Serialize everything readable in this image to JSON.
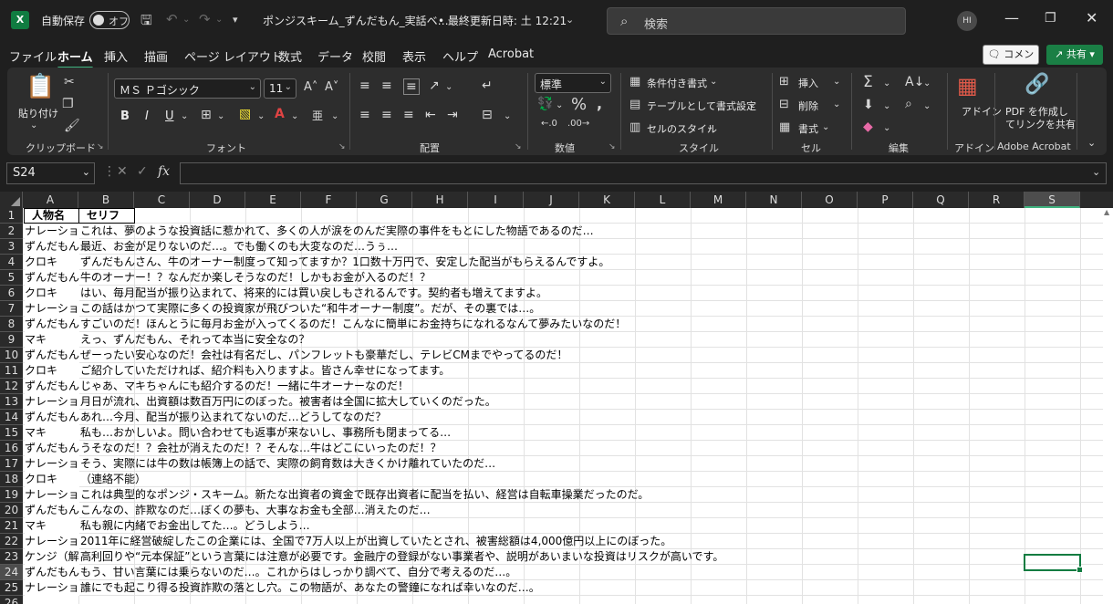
{
  "titlebar": {
    "app_icon": "X",
    "autosave_label": "自動保存",
    "autosave_state": "オフ",
    "filename": "ポンジスキーム_ずんだもん_実話ベ…",
    "last_modified": "• 最終更新日時: 土 12:21",
    "search_placeholder": "検索",
    "avatar_initials": "HI"
  },
  "menu": {
    "tabs": [
      "ファイル",
      "ホーム",
      "挿入",
      "描画",
      "ページ レイアウト",
      "数式",
      "データ",
      "校閲",
      "表示",
      "ヘルプ",
      "Acrobat"
    ],
    "active_tab": "ホーム",
    "comment_label": "コメント",
    "share_label": "共有"
  },
  "ribbon": {
    "clipboard": {
      "paste_label": "貼り付け",
      "group_label": "クリップボード"
    },
    "font": {
      "font_name": "ＭＳ Ｐゴシック",
      "font_size": "11",
      "bold": "B",
      "italic": "I",
      "underline": "U",
      "group_label": "フォント"
    },
    "alignment": {
      "group_label": "配置"
    },
    "number": {
      "format": "標準",
      "group_label": "数値"
    },
    "styles": {
      "conditional": "条件付き書式",
      "table": "テーブルとして書式設定",
      "cell_style": "セルのスタイル",
      "group_label": "スタイル"
    },
    "cells": {
      "insert": "挿入",
      "delete": "削除",
      "format": "書式",
      "group_label": "セル"
    },
    "editing": {
      "group_label": "編集"
    },
    "addins": {
      "label": "アドイン",
      "group_label": "アドイン"
    },
    "acrobat": {
      "label_line1": "PDF を作成し",
      "label_line2": "てリンクを共有",
      "group_label": "Adobe Acrobat"
    }
  },
  "formula_bar": {
    "name_box": "S24",
    "fx": "fx",
    "formula": ""
  },
  "sheet": {
    "columns": [
      "A",
      "B",
      "C",
      "D",
      "E",
      "F",
      "G",
      "H",
      "I",
      "J",
      "K",
      "L",
      "M",
      "N",
      "O",
      "P",
      "Q",
      "R",
      "S"
    ],
    "selected_column": "S",
    "selected_row": "24",
    "row_numbers": [
      "1",
      "2",
      "3",
      "4",
      "5",
      "6",
      "7",
      "8",
      "9",
      "10",
      "11",
      "12",
      "13",
      "14",
      "15",
      "16",
      "17",
      "18",
      "19",
      "20",
      "21",
      "22",
      "23",
      "24",
      "25",
      "26"
    ],
    "header": {
      "a": "人物名",
      "b": "セリフ"
    },
    "rows": [
      {
        "a": "ナレーション",
        "b": "これは、夢のような投資話に惹かれて、多くの人が涙をのんだ実際の事件をもとにした物語であるのだ…"
      },
      {
        "a": "ずんだもん",
        "b": "最近、お金が足りないのだ…。でも働くのも大変なのだ…うぅ…"
      },
      {
        "a": "クロキ",
        "b": "ずんだもんさん、牛のオーナー制度って知ってますか？1口数十万円で、安定した配当がもらえるんですよ。"
      },
      {
        "a": "ずんだもん",
        "b": "牛のオーナー！？なんだか楽しそうなのだ！しかもお金が入るのだ！？"
      },
      {
        "a": "クロキ",
        "b": "はい、毎月配当が振り込まれて、将来的には買い戻しもされるんです。契約者も増えてますよ。"
      },
      {
        "a": "ナレーション",
        "b": "この話はかつて実際に多くの投資家が飛びついた“和牛オーナー制度”。だが、その裏では…。"
      },
      {
        "a": "ずんだもん",
        "b": "すごいのだ！ほんとうに毎月お金が入ってくるのだ！こんなに簡単にお金持ちになれるなんて夢みたいなのだ！"
      },
      {
        "a": "マキ",
        "b": "えっ、ずんだもん、それって本当に安全なの？"
      },
      {
        "a": "ずんだもん",
        "b": "ぜーったい安心なのだ！会社は有名だし、パンフレットも豪華だし、テレビCMまでやってるのだ！"
      },
      {
        "a": "クロキ",
        "b": "ご紹介していただければ、紹介料も入りますよ。皆さん幸せになってます。"
      },
      {
        "a": "ずんだもん",
        "b": "じゃあ、マキちゃんにも紹介するのだ！一緒に牛オーナーなのだ！"
      },
      {
        "a": "ナレーション",
        "b": "月日が流れ、出資額は数百万円にのぼった。被害者は全国に拡大していくのだった。"
      },
      {
        "a": "ずんだもん",
        "b": "あれ…今月、配当が振り込まれてないのだ…どうしてなのだ？"
      },
      {
        "a": "マキ",
        "b": "私も…おかしいよ。問い合わせても返事が来ないし、事務所も閉まってる…"
      },
      {
        "a": "ずんだもん",
        "b": "うそなのだ！？会社が消えたのだ！？そんな…牛はどこにいったのだ！？"
      },
      {
        "a": "ナレーション",
        "b": "そう、実際には牛の数は帳簿上の話で、実際の飼育数は大きくかけ離れていたのだ…"
      },
      {
        "a": "クロキ",
        "b": "（連絡不能）"
      },
      {
        "a": "ナレーション",
        "b": "これは典型的なポンジ・スキーム。新たな出資者の資金で既存出資者に配当を払い、経営は自転車操業だったのだ。"
      },
      {
        "a": "ずんだもん",
        "b": "こんなの、詐欺なのだ…ぼくの夢も、大事なお金も全部…消えたのだ…"
      },
      {
        "a": "マキ",
        "b": "私も親に内緒でお金出してた…。どうしよう…"
      },
      {
        "a": "ナレーション",
        "b": "2011年に経営破綻したこの企業には、全国で7万人以上が出資していたとされ、被害総額は4,000億円以上にのぼった。"
      },
      {
        "a": "ケンジ（解説）",
        "b": "高利回りや“元本保証”という言葉には注意が必要です。金融庁の登録がない事業者や、説明があいまいな投資はリスクが高いです。"
      },
      {
        "a": "ずんだもん",
        "b": "もう、甘い言葉には乗らないのだ…。これからはしっかり調べて、自分で考えるのだ…。"
      },
      {
        "a": "ナレーション",
        "b": "誰にでも起こり得る投資詐欺の落とし穴。この物語が、あなたの警鐘になれば幸いなのだ…。"
      }
    ]
  },
  "colors": {
    "accent": "#107c41",
    "tab_underline": "#3fb37f",
    "share": "#1a7f45"
  }
}
